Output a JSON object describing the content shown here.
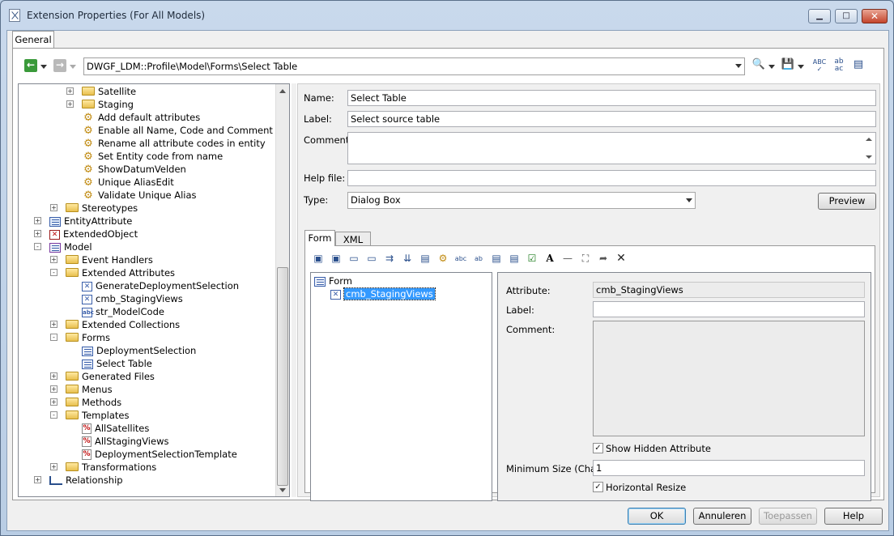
{
  "window": {
    "title": "Extension Properties (For All Models)",
    "minimize": "▁",
    "maximize": "□",
    "close": "✕"
  },
  "tabs": {
    "general": "General"
  },
  "toolbar": {
    "path": "DWGF_LDM::Profile\\Model\\Forms\\Select Table",
    "icons": [
      "back-arrow-icon",
      "forward-arrow-icon",
      "find-icon",
      "save-icon",
      "spell-check-icon",
      "replace-icon",
      "properties-icon"
    ]
  },
  "tree": {
    "items": [
      {
        "label": "Satellite",
        "icon": "folder",
        "expand": "+",
        "level": 3
      },
      {
        "label": "Staging",
        "icon": "folder",
        "expand": "+",
        "level": 3
      },
      {
        "label": "Add default attributes",
        "icon": "gear",
        "expand": "",
        "level": 3
      },
      {
        "label": "Enable all Name, Code and Comment",
        "icon": "gear",
        "expand": "",
        "level": 3
      },
      {
        "label": "Rename all attribute codes in entity",
        "icon": "gear",
        "expand": "",
        "level": 3
      },
      {
        "label": "Set Entity code from name",
        "icon": "gear",
        "expand": "",
        "level": 3
      },
      {
        "label": "ShowDatumVelden",
        "icon": "gear",
        "expand": "",
        "level": 3
      },
      {
        "label": "Unique AliasEdit",
        "icon": "gear",
        "expand": "",
        "level": 3
      },
      {
        "label": "Validate Unique Alias",
        "icon": "gear",
        "expand": "",
        "level": 3
      },
      {
        "label": "Stereotypes",
        "icon": "folder",
        "expand": "+",
        "level": 2
      },
      {
        "label": "EntityAttribute",
        "icon": "entityattr",
        "expand": "+",
        "level": 1
      },
      {
        "label": "ExtendedObject",
        "icon": "xred",
        "expand": "+",
        "level": 1
      },
      {
        "label": "Model",
        "icon": "model",
        "expand": "-",
        "level": 1
      },
      {
        "label": "Event Handlers",
        "icon": "folder",
        "expand": "+",
        "level": 2
      },
      {
        "label": "Extended Attributes",
        "icon": "folder",
        "expand": "-",
        "level": 2
      },
      {
        "label": "GenerateDeploymentSelection",
        "icon": "xbox",
        "expand": "",
        "level": 3
      },
      {
        "label": "cmb_StagingViews",
        "icon": "xbox",
        "expand": "",
        "level": 3
      },
      {
        "label": "str_ModelCode",
        "icon": "abc",
        "expand": "",
        "level": 3
      },
      {
        "label": "Extended Collections",
        "icon": "folder",
        "expand": "+",
        "level": 2
      },
      {
        "label": "Forms",
        "icon": "folder",
        "expand": "-",
        "level": 2
      },
      {
        "label": "DeploymentSelection",
        "icon": "form",
        "expand": "",
        "level": 3
      },
      {
        "label": "Select Table",
        "icon": "form",
        "expand": "",
        "level": 3
      },
      {
        "label": "Generated Files",
        "icon": "folder",
        "expand": "+",
        "level": 2
      },
      {
        "label": "Menus",
        "icon": "folder",
        "expand": "+",
        "level": 2
      },
      {
        "label": "Methods",
        "icon": "folder",
        "expand": "+",
        "level": 2
      },
      {
        "label": "Templates",
        "icon": "folder",
        "expand": "-",
        "level": 2
      },
      {
        "label": "AllSatellites",
        "icon": "pct",
        "expand": "",
        "level": 3
      },
      {
        "label": "AllStagingViews",
        "icon": "pct",
        "expand": "",
        "level": 3
      },
      {
        "label": "DeploymentSelectionTemplate",
        "icon": "pct",
        "expand": "",
        "level": 3
      },
      {
        "label": "Transformations",
        "icon": "folder",
        "expand": "+",
        "level": 2
      },
      {
        "label": "Relationship",
        "icon": "relation",
        "expand": "+",
        "level": 1
      }
    ]
  },
  "props": {
    "name_label": "Name:",
    "name_value": "Select Table",
    "label_label": "Label:",
    "label_value": "Select source table",
    "comment_label": "Comment:",
    "comment_value": "",
    "helpfile_label": "Help file:",
    "helpfile_value": "",
    "type_label": "Type:",
    "type_value": "Dialog Box",
    "preview_button": "Preview"
  },
  "subtabs": {
    "form": "Form",
    "xml": "XML"
  },
  "form_tree": {
    "root": "Form",
    "child": "cmb_StagingViews"
  },
  "form_props": {
    "attribute_label": "Attribute:",
    "attribute_value": "cmb_StagingViews",
    "label_label": "Label:",
    "label_value": "",
    "comment_label": "Comment:",
    "comment_value": "",
    "show_hidden_label": "Show Hidden Attribute",
    "show_hidden_checked": "✓",
    "minsize_label": "Minimum Size (Chars):",
    "minsize_value": "1",
    "hresize_label": "Horizontal Resize",
    "hresize_checked": "✓"
  },
  "buttons": {
    "ok": "OK",
    "cancel": "Annuleren",
    "apply": "Toepassen",
    "help": "Help"
  }
}
